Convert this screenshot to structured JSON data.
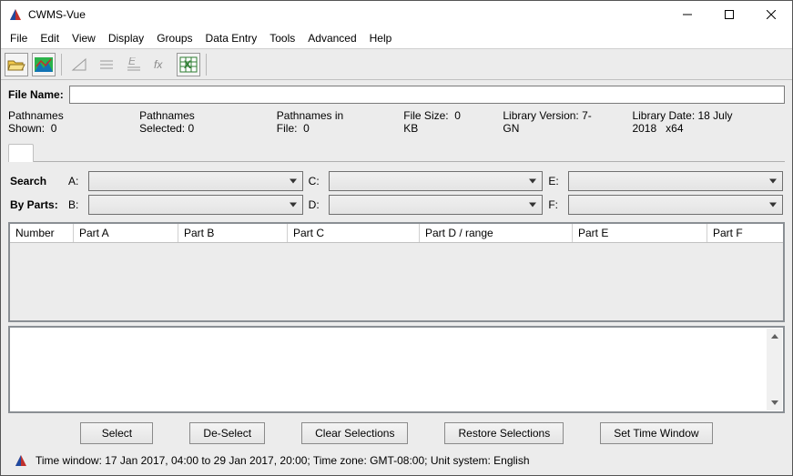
{
  "window": {
    "title": "CWMS-Vue"
  },
  "menu": {
    "items": [
      "File",
      "Edit",
      "View",
      "Display",
      "Groups",
      "Data Entry",
      "Tools",
      "Advanced",
      "Help"
    ]
  },
  "toolbar": {
    "open_icon": "open-folder-icon",
    "chart_icon": "chart-landscape-icon",
    "grey1_icon": "grey-tool-icon",
    "grey2_icon": "grey-lines-icon",
    "grey3_icon": "grey-e-lines-icon",
    "fx_icon": "fx-icon",
    "excel_icon": "excel-icon"
  },
  "filename": {
    "label": "File Name:",
    "value": ""
  },
  "stats": {
    "pathnames_shown_label": "Pathnames Shown:",
    "pathnames_shown_value": "0",
    "pathnames_selected_label": "Pathnames Selected:",
    "pathnames_selected_value": "0",
    "pathnames_in_file_label": "Pathnames in File:",
    "pathnames_in_file_value": "0",
    "file_size_label": "File Size:",
    "file_size_value": "0  KB",
    "library_version_label": "Library Version:",
    "library_version_value": "7-GN",
    "library_date_label": "Library Date:",
    "library_date_value": "18 July 2018",
    "arch": "x64"
  },
  "search": {
    "row1_label": "Search",
    "row2_label": "By Parts:",
    "a_label": "A:",
    "b_label": "B:",
    "c_label": "C:",
    "d_label": "D:",
    "e_label": "E:",
    "f_label": "F:",
    "a_value": "",
    "b_value": "",
    "c_value": "",
    "d_value": "",
    "e_value": "",
    "f_value": ""
  },
  "table": {
    "columns": [
      "Number",
      "Part A",
      "Part B",
      "Part C",
      "Part D / range",
      "Part E",
      "Part F"
    ],
    "rows": []
  },
  "buttons": {
    "select": "Select",
    "deselect": "De-Select",
    "clear": "Clear Selections",
    "restore": "Restore Selections",
    "set_time": "Set Time Window"
  },
  "status": {
    "text": "Time window:  17 Jan 2017, 04:00   to   29 Jan 2017, 20:00;  Time zone: GMT-08:00;  Unit system: English"
  }
}
